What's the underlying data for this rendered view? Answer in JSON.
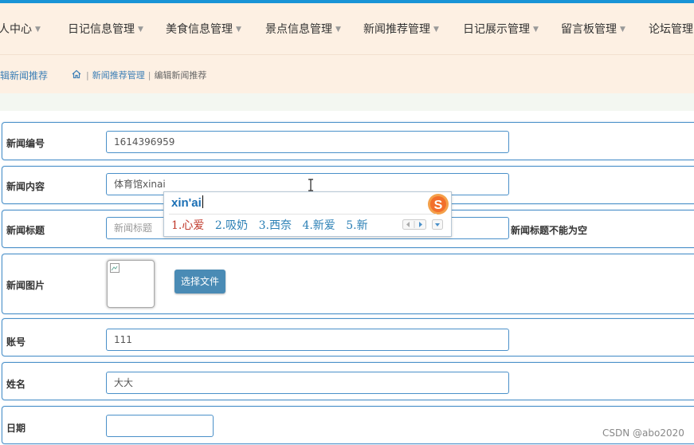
{
  "nav": {
    "items": [
      {
        "label": "人中心"
      },
      {
        "label": "日记信息管理"
      },
      {
        "label": "美食信息管理"
      },
      {
        "label": "景点信息管理"
      },
      {
        "label": "新闻推荐管理"
      },
      {
        "label": "日记展示管理"
      },
      {
        "label": "留言板管理"
      },
      {
        "label": "论坛管理"
      }
    ]
  },
  "subbar": {
    "title": "编辑新闻推荐",
    "breadcrumb": [
      "新闻推荐管理",
      "编辑新闻推荐"
    ]
  },
  "form": {
    "news_number": {
      "label": "新闻编号",
      "value": "1614396959"
    },
    "news_content": {
      "label": "新闻内容",
      "value": "体育馆xinai"
    },
    "news_title": {
      "label": "新闻标题",
      "placeholder": "新闻标题",
      "error": "新闻标题不能为空"
    },
    "news_image": {
      "label": "新闻图片",
      "button": "选择文件"
    },
    "account": {
      "label": "账号",
      "value": "111"
    },
    "name": {
      "label": "姓名",
      "value": "大大"
    },
    "date": {
      "label": "日期",
      "value": ""
    }
  },
  "ime": {
    "pinyin": "xin'ai",
    "candidates": [
      "1.心爱",
      "2.吸奶",
      "3.西奈",
      "4.新爱",
      "5.新"
    ]
  },
  "watermark": "CSDN @abo2020",
  "colors": {
    "accent": "#4a90c9",
    "navbar_bg": "#fdf0e3",
    "button": "#4a8bb5",
    "top_line": "#1a94d6"
  }
}
